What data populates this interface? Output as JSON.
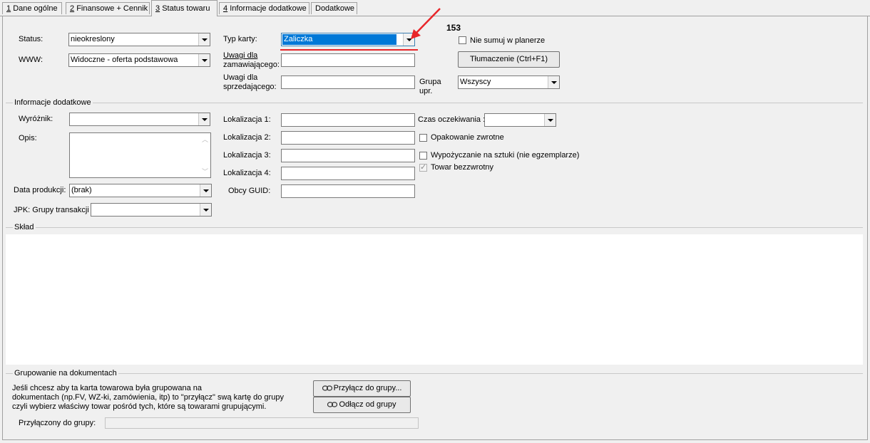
{
  "tabs": [
    {
      "key": "1",
      "label": "Dane ogólne"
    },
    {
      "key": "2",
      "label": "Finansowe + Cennik"
    },
    {
      "key": "3",
      "label": "Status towaru"
    },
    {
      "key": "4",
      "label": "Informacje dodatkowe"
    },
    {
      "key": "",
      "label": "Dodatkowe"
    }
  ],
  "status": {
    "label": "Status:",
    "value": "nieokreslony"
  },
  "www": {
    "label": "WWW:",
    "value": "Widoczne - oferta podstawowa"
  },
  "typ_karty": {
    "label": "Typ karty:",
    "value": "Zaliczka"
  },
  "uwagi_zam": {
    "label_line1": "Uwagi dla",
    "label_line2": "zamawiającego:",
    "value": ""
  },
  "uwagi_sprz": {
    "label_line1": "Uwagi dla",
    "label_line2": "sprzedającego:",
    "value": ""
  },
  "annotation_number": "153",
  "nie_sumuj": {
    "label": "Nie sumuj w planerze",
    "checked": false
  },
  "tlumaczenie_button": "Tłumaczenie (Ctrl+F1)",
  "grupa_upr": {
    "label_line1": "Grupa",
    "label_line2": "upr.",
    "value": "Wszyscy"
  },
  "info_dodatkowe": {
    "title": "Informacje dodatkowe",
    "wyroznik": {
      "label": "Wyróżnik:",
      "value": ""
    },
    "opis": {
      "label": "Opis:",
      "value": ""
    },
    "data_produkcji": {
      "label": "Data produkcji:",
      "value": "(brak)"
    },
    "jpk": {
      "label": "JPK: Grupy transakcji",
      "value": ""
    },
    "lokalizacje": [
      {
        "label": "Lokalizacja 1:",
        "value": ""
      },
      {
        "label": "Lokalizacja 2:",
        "value": ""
      },
      {
        "label": "Lokalizacja 3:",
        "value": ""
      },
      {
        "label": "Lokalizacja 4:",
        "value": ""
      }
    ],
    "obcy_guid": {
      "label": "Obcy GUID:",
      "value": ""
    },
    "czas_oczekiwania": {
      "label": "Czas oczekiwania :",
      "value": ""
    },
    "opakowanie_zwrotne": {
      "label": "Opakowanie zwrotne",
      "checked": false
    },
    "wypozyczanie": {
      "label": "Wypożyczanie na sztuki (nie egzemplarze)",
      "checked": false
    },
    "towar_bezzwrotny": {
      "label": "Towar bezzwrotny",
      "checked": true
    }
  },
  "sklad": {
    "title": "Skład"
  },
  "grupowanie": {
    "title": "Grupowanie na dokumentach",
    "description_lines": [
      "Jeśli chcesz aby ta karta towarowa była grupowana na",
      "dokumentach (np.FV, WZ-ki, zamówienia, itp) to \"przyłącz\" swą kartę do grupy",
      "czyli wybierz właściwy towar pośród tych, które są towarami grupującymi."
    ],
    "przylacz_button": "Przyłącz do grupy...",
    "odlacz_button": "Odłącz od grupy",
    "przylaczony_label": "Przyłączony do grupy:",
    "przylaczony_value": ""
  },
  "colors": {
    "selection": "#0078d7",
    "annotation_red": "#e8262a",
    "background": "#f0f0f0"
  }
}
